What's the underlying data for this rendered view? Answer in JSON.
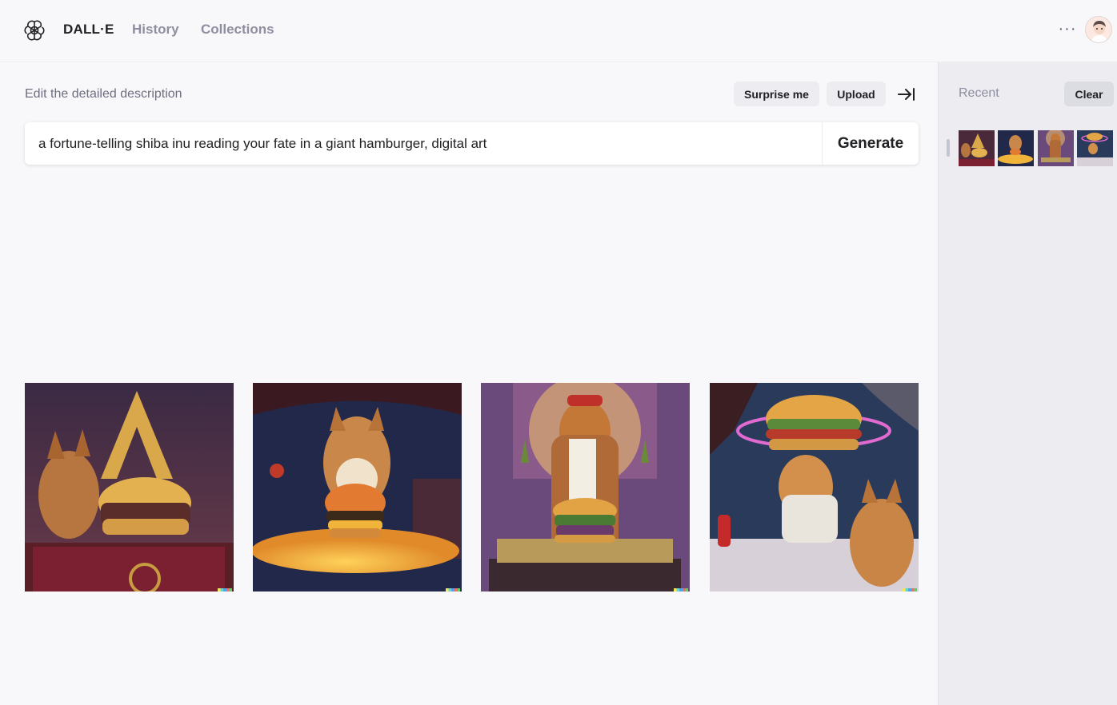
{
  "nav": {
    "brand": "DALL·E",
    "history": "History",
    "collections": "Collections",
    "more": "···"
  },
  "editor": {
    "label": "Edit the detailed description",
    "surprise_label": "Surprise me",
    "upload_label": "Upload",
    "prompt_value": "a fortune-telling shiba inu reading your fate in a giant hamburger, digital art",
    "generate_label": "Generate"
  },
  "sidebar": {
    "recent_label": "Recent",
    "clear_label": "Clear"
  },
  "icons": {
    "logo": "openai-logo-icon",
    "collapse": "collapse-panel-icon",
    "more": "more-horizontal-icon"
  },
  "colors": {
    "background": "#f8f8fb",
    "sidebar": "#ececf1",
    "muted_text": "#8e8ea0",
    "pill": "#ececf1"
  }
}
